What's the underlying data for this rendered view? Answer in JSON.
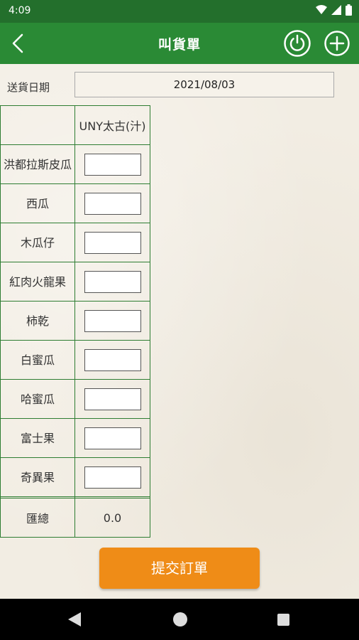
{
  "status_bar": {
    "time": "4:09"
  },
  "app_bar": {
    "title": "叫貨單"
  },
  "delivery": {
    "label": "送貨日期",
    "date": "2021/08/03"
  },
  "table": {
    "store_header": "UNY太古(汁)",
    "items": [
      {
        "name": "洪都拉斯皮瓜",
        "qty": ""
      },
      {
        "name": "西瓜",
        "qty": ""
      },
      {
        "name": "木瓜仔",
        "qty": ""
      },
      {
        "name": "紅肉火龍果",
        "qty": ""
      },
      {
        "name": "柿乾",
        "qty": ""
      },
      {
        "name": "白蜜瓜",
        "qty": ""
      },
      {
        "name": "哈蜜瓜",
        "qty": ""
      },
      {
        "name": "富士果",
        "qty": ""
      },
      {
        "name": "奇異果",
        "qty": ""
      }
    ],
    "total_label": "匯總",
    "total_value": "0.0"
  },
  "submit": {
    "label": "提交訂單"
  },
  "colors": {
    "primary": "#2a8a35",
    "status": "#236f2c",
    "accent": "#ef8c17"
  }
}
